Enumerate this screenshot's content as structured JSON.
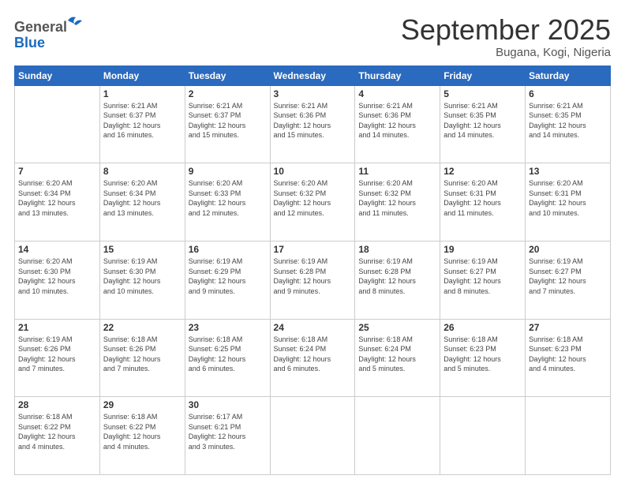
{
  "header": {
    "logo": {
      "general": "General",
      "blue": "Blue"
    },
    "title": "September 2025",
    "location": "Bugana, Kogi, Nigeria"
  },
  "days_of_week": [
    "Sunday",
    "Monday",
    "Tuesday",
    "Wednesday",
    "Thursday",
    "Friday",
    "Saturday"
  ],
  "weeks": [
    [
      {
        "day": "",
        "info": ""
      },
      {
        "day": "1",
        "info": "Sunrise: 6:21 AM\nSunset: 6:37 PM\nDaylight: 12 hours\nand 16 minutes."
      },
      {
        "day": "2",
        "info": "Sunrise: 6:21 AM\nSunset: 6:37 PM\nDaylight: 12 hours\nand 15 minutes."
      },
      {
        "day": "3",
        "info": "Sunrise: 6:21 AM\nSunset: 6:36 PM\nDaylight: 12 hours\nand 15 minutes."
      },
      {
        "day": "4",
        "info": "Sunrise: 6:21 AM\nSunset: 6:36 PM\nDaylight: 12 hours\nand 14 minutes."
      },
      {
        "day": "5",
        "info": "Sunrise: 6:21 AM\nSunset: 6:35 PM\nDaylight: 12 hours\nand 14 minutes."
      },
      {
        "day": "6",
        "info": "Sunrise: 6:21 AM\nSunset: 6:35 PM\nDaylight: 12 hours\nand 14 minutes."
      }
    ],
    [
      {
        "day": "7",
        "info": "Sunrise: 6:20 AM\nSunset: 6:34 PM\nDaylight: 12 hours\nand 13 minutes."
      },
      {
        "day": "8",
        "info": "Sunrise: 6:20 AM\nSunset: 6:34 PM\nDaylight: 12 hours\nand 13 minutes."
      },
      {
        "day": "9",
        "info": "Sunrise: 6:20 AM\nSunset: 6:33 PM\nDaylight: 12 hours\nand 12 minutes."
      },
      {
        "day": "10",
        "info": "Sunrise: 6:20 AM\nSunset: 6:32 PM\nDaylight: 12 hours\nand 12 minutes."
      },
      {
        "day": "11",
        "info": "Sunrise: 6:20 AM\nSunset: 6:32 PM\nDaylight: 12 hours\nand 11 minutes."
      },
      {
        "day": "12",
        "info": "Sunrise: 6:20 AM\nSunset: 6:31 PM\nDaylight: 12 hours\nand 11 minutes."
      },
      {
        "day": "13",
        "info": "Sunrise: 6:20 AM\nSunset: 6:31 PM\nDaylight: 12 hours\nand 10 minutes."
      }
    ],
    [
      {
        "day": "14",
        "info": "Sunrise: 6:20 AM\nSunset: 6:30 PM\nDaylight: 12 hours\nand 10 minutes."
      },
      {
        "day": "15",
        "info": "Sunrise: 6:19 AM\nSunset: 6:30 PM\nDaylight: 12 hours\nand 10 minutes."
      },
      {
        "day": "16",
        "info": "Sunrise: 6:19 AM\nSunset: 6:29 PM\nDaylight: 12 hours\nand 9 minutes."
      },
      {
        "day": "17",
        "info": "Sunrise: 6:19 AM\nSunset: 6:28 PM\nDaylight: 12 hours\nand 9 minutes."
      },
      {
        "day": "18",
        "info": "Sunrise: 6:19 AM\nSunset: 6:28 PM\nDaylight: 12 hours\nand 8 minutes."
      },
      {
        "day": "19",
        "info": "Sunrise: 6:19 AM\nSunset: 6:27 PM\nDaylight: 12 hours\nand 8 minutes."
      },
      {
        "day": "20",
        "info": "Sunrise: 6:19 AM\nSunset: 6:27 PM\nDaylight: 12 hours\nand 7 minutes."
      }
    ],
    [
      {
        "day": "21",
        "info": "Sunrise: 6:19 AM\nSunset: 6:26 PM\nDaylight: 12 hours\nand 7 minutes."
      },
      {
        "day": "22",
        "info": "Sunrise: 6:18 AM\nSunset: 6:26 PM\nDaylight: 12 hours\nand 7 minutes."
      },
      {
        "day": "23",
        "info": "Sunrise: 6:18 AM\nSunset: 6:25 PM\nDaylight: 12 hours\nand 6 minutes."
      },
      {
        "day": "24",
        "info": "Sunrise: 6:18 AM\nSunset: 6:24 PM\nDaylight: 12 hours\nand 6 minutes."
      },
      {
        "day": "25",
        "info": "Sunrise: 6:18 AM\nSunset: 6:24 PM\nDaylight: 12 hours\nand 5 minutes."
      },
      {
        "day": "26",
        "info": "Sunrise: 6:18 AM\nSunset: 6:23 PM\nDaylight: 12 hours\nand 5 minutes."
      },
      {
        "day": "27",
        "info": "Sunrise: 6:18 AM\nSunset: 6:23 PM\nDaylight: 12 hours\nand 4 minutes."
      }
    ],
    [
      {
        "day": "28",
        "info": "Sunrise: 6:18 AM\nSunset: 6:22 PM\nDaylight: 12 hours\nand 4 minutes."
      },
      {
        "day": "29",
        "info": "Sunrise: 6:18 AM\nSunset: 6:22 PM\nDaylight: 12 hours\nand 4 minutes."
      },
      {
        "day": "30",
        "info": "Sunrise: 6:17 AM\nSunset: 6:21 PM\nDaylight: 12 hours\nand 3 minutes."
      },
      {
        "day": "",
        "info": ""
      },
      {
        "day": "",
        "info": ""
      },
      {
        "day": "",
        "info": ""
      },
      {
        "day": "",
        "info": ""
      }
    ]
  ]
}
